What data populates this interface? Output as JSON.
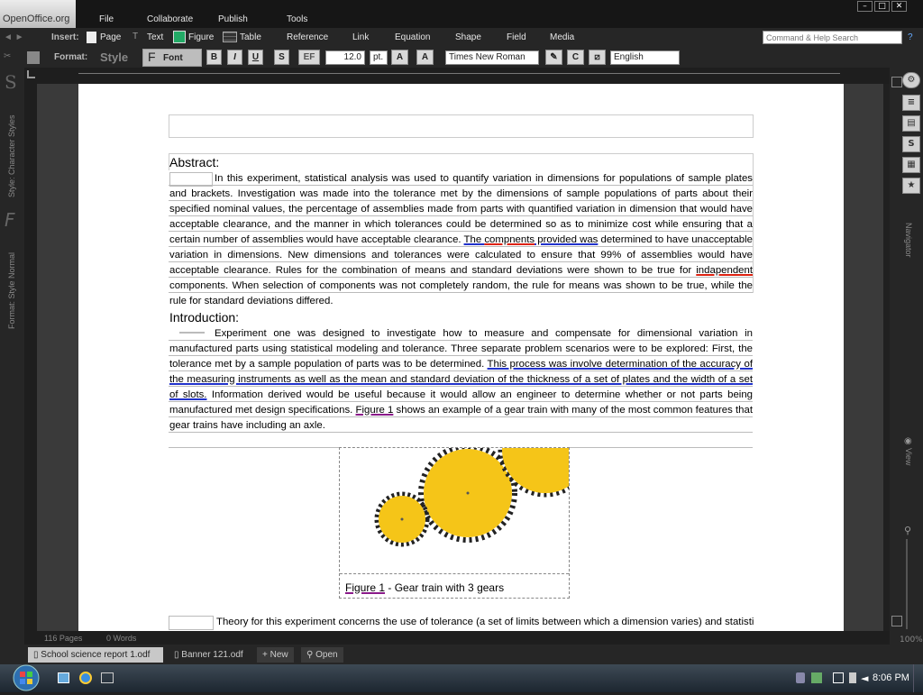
{
  "app": {
    "logo": "OpenOffice",
    "logo_suffix": ".org"
  },
  "menu": [
    "File",
    "Collaborate",
    "Publish",
    "Tools"
  ],
  "window_controls": {
    "minimize": "–",
    "maximize": "□",
    "close": "✕"
  },
  "toolbar1": {
    "insert_label": "Insert:",
    "items": [
      "Page",
      "Text",
      "Figure",
      "Table",
      "Reference",
      "Link",
      "Equation",
      "Shape",
      "Field",
      "Media"
    ],
    "search_placeholder": "Command & Help Search",
    "help": "?"
  },
  "toolbar2": {
    "format_label": "Format:",
    "style_label": "Style",
    "font_label": "Font",
    "bold": "B",
    "italic": "I",
    "underline": "U",
    "strike": "S",
    "font_size": "12.0",
    "size_unit": "pt.",
    "superscript": "A",
    "subscript": "A",
    "font_name": "Times New Roman",
    "language": "English"
  },
  "left_panel": {
    "char_styles": "Style: Character Styles",
    "format_style": "Format: Style Normal"
  },
  "right_panel": {
    "navigator": "Navigator",
    "view": "View",
    "zoom": "100%"
  },
  "document": {
    "abstract_heading": "Abstract:",
    "abstract_p1": "In this experiment, statistical analysis was used to quantify variation in dimensions for populations of sample plates and brackets.  Investigation was made into the tolerance met by the dimensions of sample populations of parts about their specified nominal values, the percentage of assemblies made from parts with quantified variation in dimension that would have acceptable clearance, and the manner in which tolerances could be determined so as to minimize cost while ensuring that a certain number of assemblies would have acceptable clearance.  ",
    "abstract_ul1a": "The ",
    "abstract_ul1b": "compnents",
    "abstract_ul1c": " provided was",
    "abstract_p2": " determined to have unacceptable variation in dimensions.  New dimensions and tolerances were calculated to ensure that 99% of assemblies would have acceptable clearance.  Rules for the combination of means and standard deviations were shown to be true for ",
    "abstract_ul2": "indapendent",
    "abstract_p3": " components.  When selection of components was not completely random, the rule for means was shown to be true, while the rule for standard deviations differed.",
    "intro_heading": "Introduction:",
    "intro_p1": "Experiment one was designed to investigate how to measure and compensate for dimensional variation in manufactured parts using statistical modeling and tolerance.  Three separate problem scenarios were to be explored:  First, the tolerance met by a sample population of parts was to be determined.  ",
    "intro_ul": "This process was involve determination of the accuracy of the measuring instruments as well as the mean and standard deviation of the thickness of a set of plates and the width of a set of slots.",
    "intro_p2": "  Information derived would be useful because it would allow an engineer to determine whether or not parts being manufactured met design specifications.  ",
    "intro_fig_ref": "Figure 1",
    "intro_p3": " shows an example of a gear train with many of the most common features that gear trains have including an axle.",
    "figure_caption_ref": "Figure 1",
    "figure_caption_rest": " - Gear train with 3 gears",
    "theory_p": "Theory for this experiment concerns the use of tolerance (a set of limits between which a dimension varies) and statistical"
  },
  "status": {
    "pages": "116 Pages",
    "words": "0 Words"
  },
  "tabs": [
    {
      "label": "School science report 1.odf"
    },
    {
      "label": "Banner 121.odf"
    },
    {
      "label": "New"
    },
    {
      "label": "Open"
    }
  ],
  "taskbar": {
    "time": "8:06 PM"
  },
  "colors": {
    "gear": "#f5c518",
    "spell_red": "#dd2211",
    "grammar_blue": "#2233cc",
    "link_purple": "#8a1a8a"
  }
}
